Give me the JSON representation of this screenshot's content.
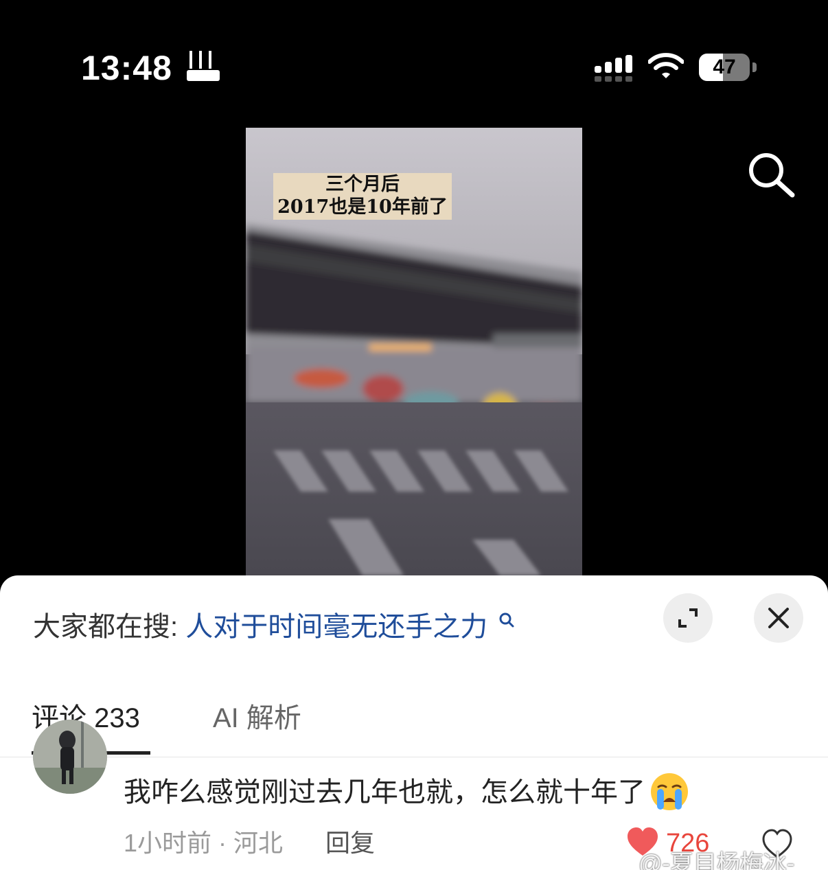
{
  "status_bar": {
    "time": "13:48",
    "signal_icon": "cellular-signal-icon",
    "wifi_icon": "wifi-icon",
    "battery_percent": 47
  },
  "video": {
    "caption_line1": "三个月后",
    "caption_line2": "2017也是10年前了"
  },
  "header": {
    "search_icon": "search-icon"
  },
  "sheet": {
    "trending_label": "大家都在搜:",
    "trending_query": "人对于时间毫无还手之力",
    "expand_icon": "expand-icon",
    "close_icon": "close-icon"
  },
  "tabs": [
    {
      "label": "评论 233",
      "active": true
    },
    {
      "label": "AI 解析",
      "active": false
    }
  ],
  "comment": {
    "text": "我咋么感觉刚过去几年也就，怎么就十年了",
    "emoji": "crying-face-emoji",
    "meta": "1小时前 · 河北",
    "reply_label": "回复",
    "like_count": "726"
  },
  "watermark": "@-夏目杨梅冰-",
  "colors": {
    "link": "#1f4d9a",
    "like": "#e8453c",
    "caption_bg": "#e8d9bf"
  }
}
